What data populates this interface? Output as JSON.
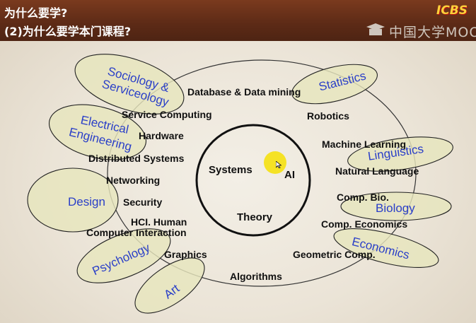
{
  "header": {
    "line1": "为什么要学?",
    "line2": "(2)为什么要学本门课程?",
    "logo_text": "中国大学MOOC",
    "badge": "ICBS"
  },
  "diagram": {
    "core": {
      "systems": "Systems",
      "ai": "AI",
      "theory": "Theory"
    },
    "topics": {
      "database": "Database & Data mining",
      "service_computing": "Service Computing",
      "hardware": "Hardware",
      "distributed_systems": "Distributed Systems",
      "networking": "Networking",
      "security": "Security",
      "hci_line1": "HCI.  Human",
      "hci_line2": "Computer Interaction",
      "graphics": "Graphics",
      "algorithms": "Algorithms",
      "geometric_comp": "Geometric Comp.",
      "comp_economics": "Comp. Economics",
      "comp_bio": "Comp. Bio.",
      "natural_language": "Natural Language",
      "machine_learning": "Machine Learning",
      "robotics": "Robotics"
    },
    "fields": {
      "sociology_line1": "Sociology &",
      "sociology_line2": "Serviceology",
      "electrical_line1": "Electrical",
      "electrical_line2": "Engineering",
      "design": "Design",
      "psychology": "Psychology",
      "art": "Art",
      "statistics": "Statistics",
      "linguistics": "Linguistics",
      "biology": "Biology",
      "economics": "Economics"
    }
  },
  "colors": {
    "header_bg": "#5c2a16",
    "field_text": "#2a3fc8",
    "ellipse_fill": "#e6e5bd",
    "pointer": "#f4e21a"
  }
}
